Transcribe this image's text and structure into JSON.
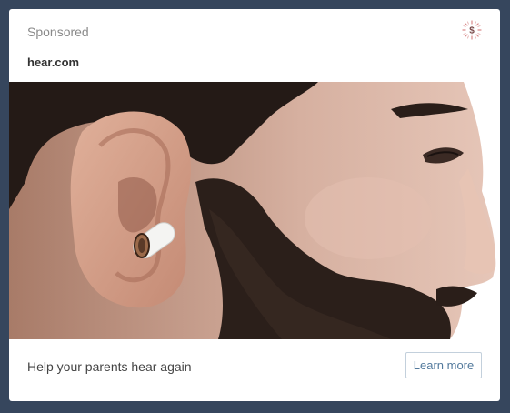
{
  "ad": {
    "sponsored_label": "Sponsored",
    "badge_symbol": "$",
    "advertiser": "hear.com",
    "image_subject": "Side profile of a bearded man wearing a small white in-ear hearing aid",
    "tagline": "Help your parents hear again",
    "cta_label": "Learn more"
  },
  "colors": {
    "page_background": "#36465d",
    "card_background": "#ffffff",
    "cta_text": "#52799c",
    "badge_accent": "#d98a8a"
  },
  "icons": {
    "badge": "dollar-badge-icon"
  }
}
